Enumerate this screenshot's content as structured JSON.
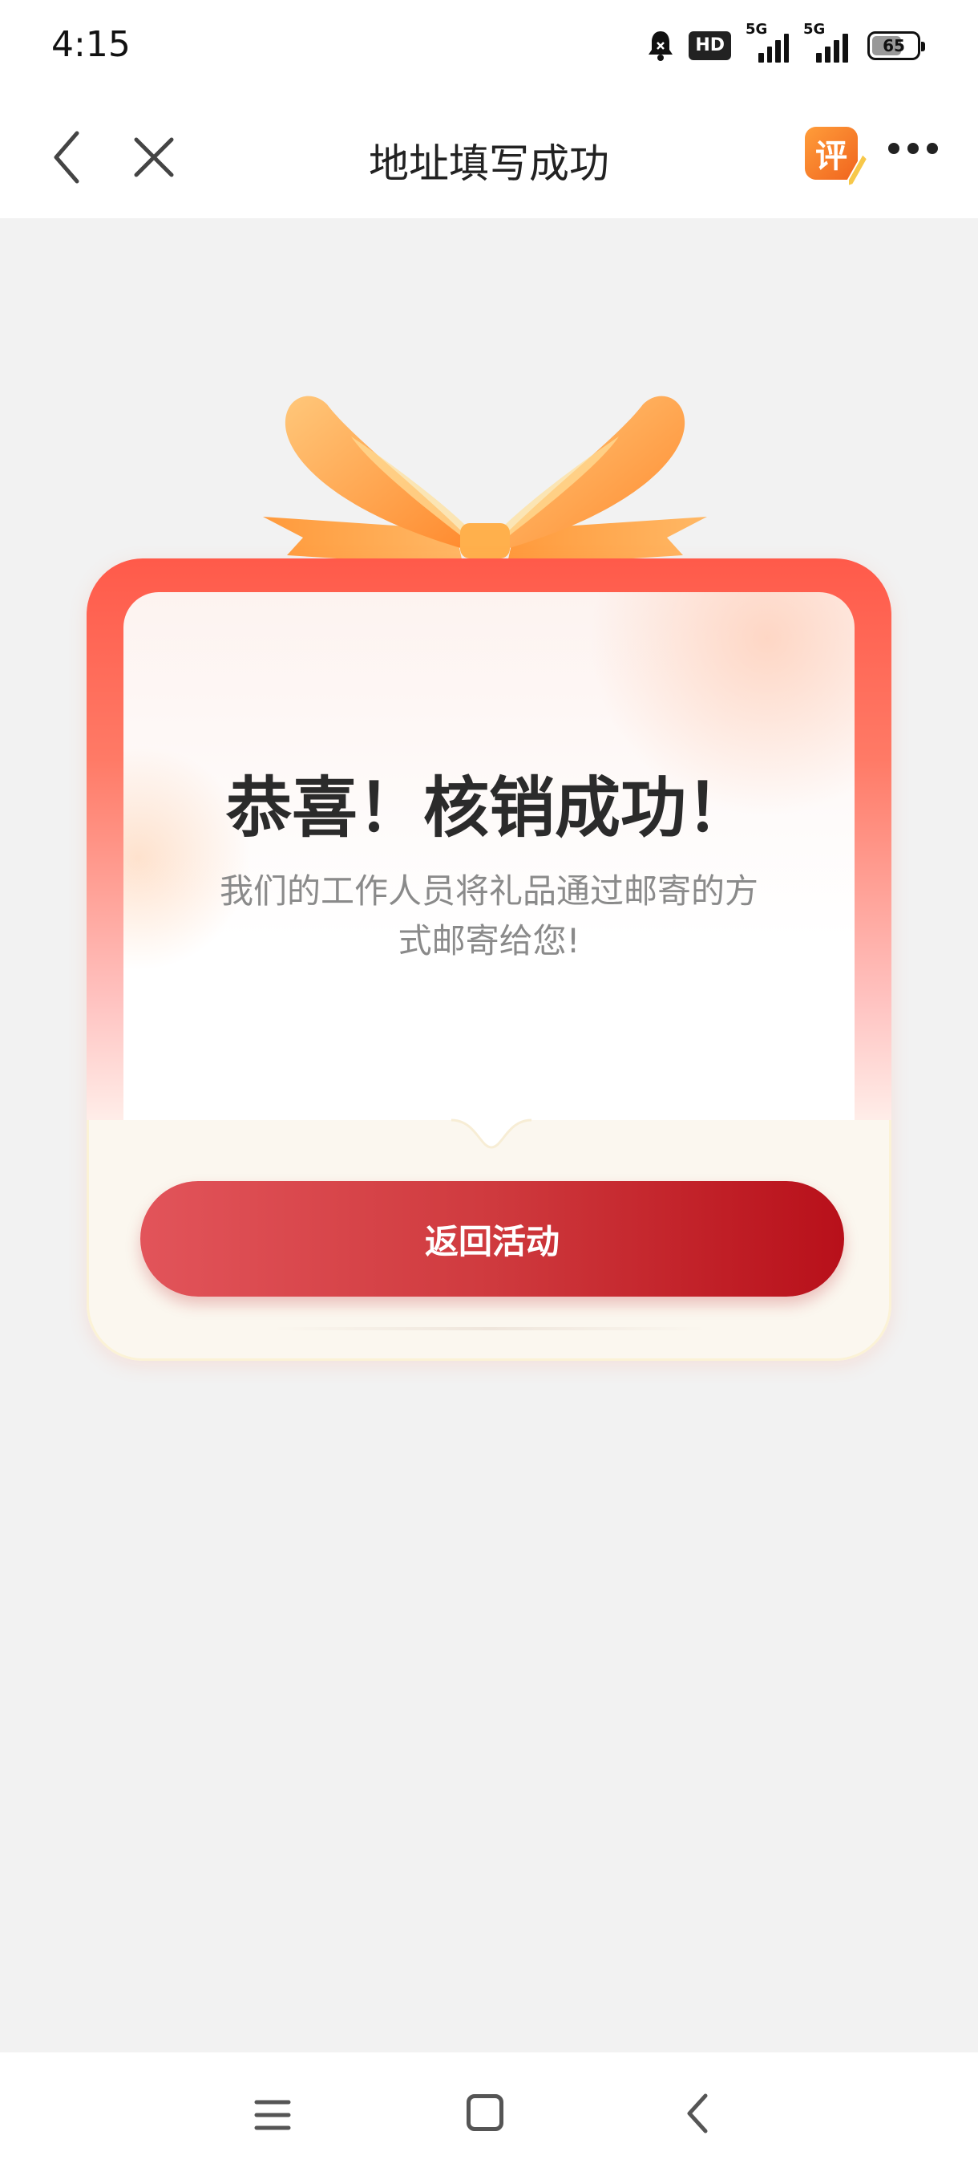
{
  "status_bar": {
    "time": "4:15",
    "hd_badge": "HD",
    "signal_1_label": "5G",
    "signal_2_label": "5G",
    "battery_level": "65",
    "icons": [
      "bell-icon",
      "hd-icon",
      "signal-5g-icon",
      "signal-5g-icon",
      "battery-icon"
    ]
  },
  "nav": {
    "title": "地址填写成功",
    "review_label": "评",
    "icons": [
      "back-icon",
      "close-icon",
      "review-icon",
      "more-icon"
    ]
  },
  "card": {
    "title": "恭喜！核销成功！",
    "subtitle": "我们的工作人员将礼品通过邮寄的方式邮寄给您!",
    "button_label": "返回活动",
    "colors": {
      "frame_top": "#ff5a4a",
      "bow": "#ff9a3c",
      "button_start": "#e2545a",
      "button_end": "#b8101a"
    }
  },
  "system_nav": {
    "icons": [
      "menu-icon",
      "home-icon",
      "back-icon"
    ]
  }
}
